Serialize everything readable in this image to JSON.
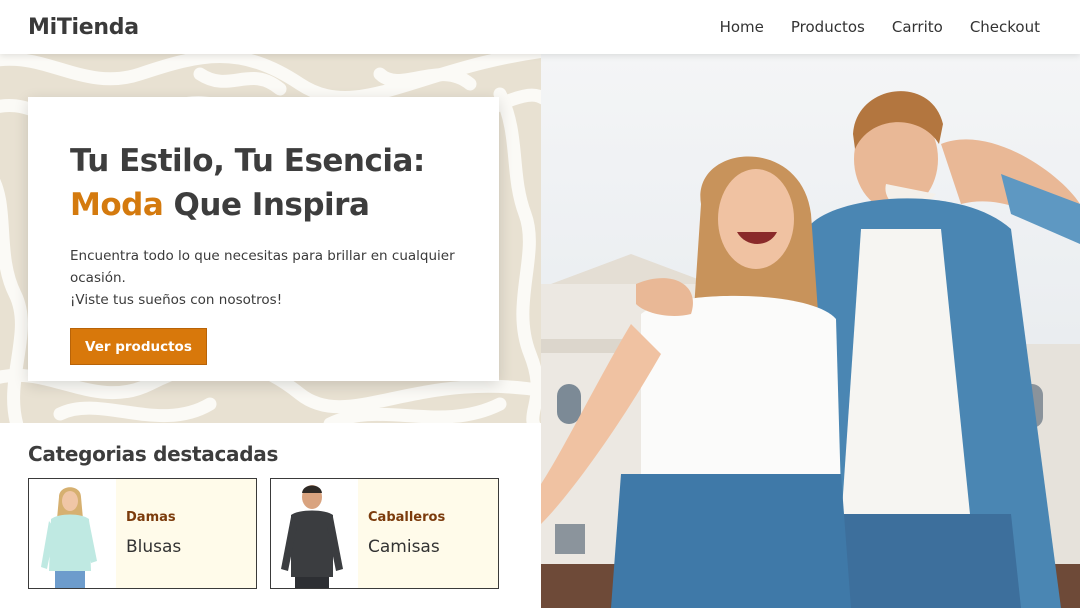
{
  "header": {
    "logo": "MiTienda",
    "nav": [
      "Home",
      "Productos",
      "Carrito",
      "Checkout"
    ]
  },
  "hero": {
    "title_line1": "Tu Estilo, Tu Esencia:",
    "title_accent": "Moda",
    "title_rest": " Que Inspira",
    "text_line1": "Encuentra todo lo que necesitas para brillar en cualquier ocasión.",
    "text_line2": "¡Viste tus sueños con nosotros!",
    "cta": "Ver productos"
  },
  "categories": {
    "title": "Categorias destacadas",
    "items": [
      {
        "kicker": "Damas",
        "name": "Blusas"
      },
      {
        "kicker": "Caballeros",
        "name": "Camisas"
      }
    ]
  },
  "colors": {
    "accent": "#d8780b",
    "pattern": "#e8e1d2",
    "card_bg": "#fffbea",
    "kicker": "#7b3b0c"
  }
}
